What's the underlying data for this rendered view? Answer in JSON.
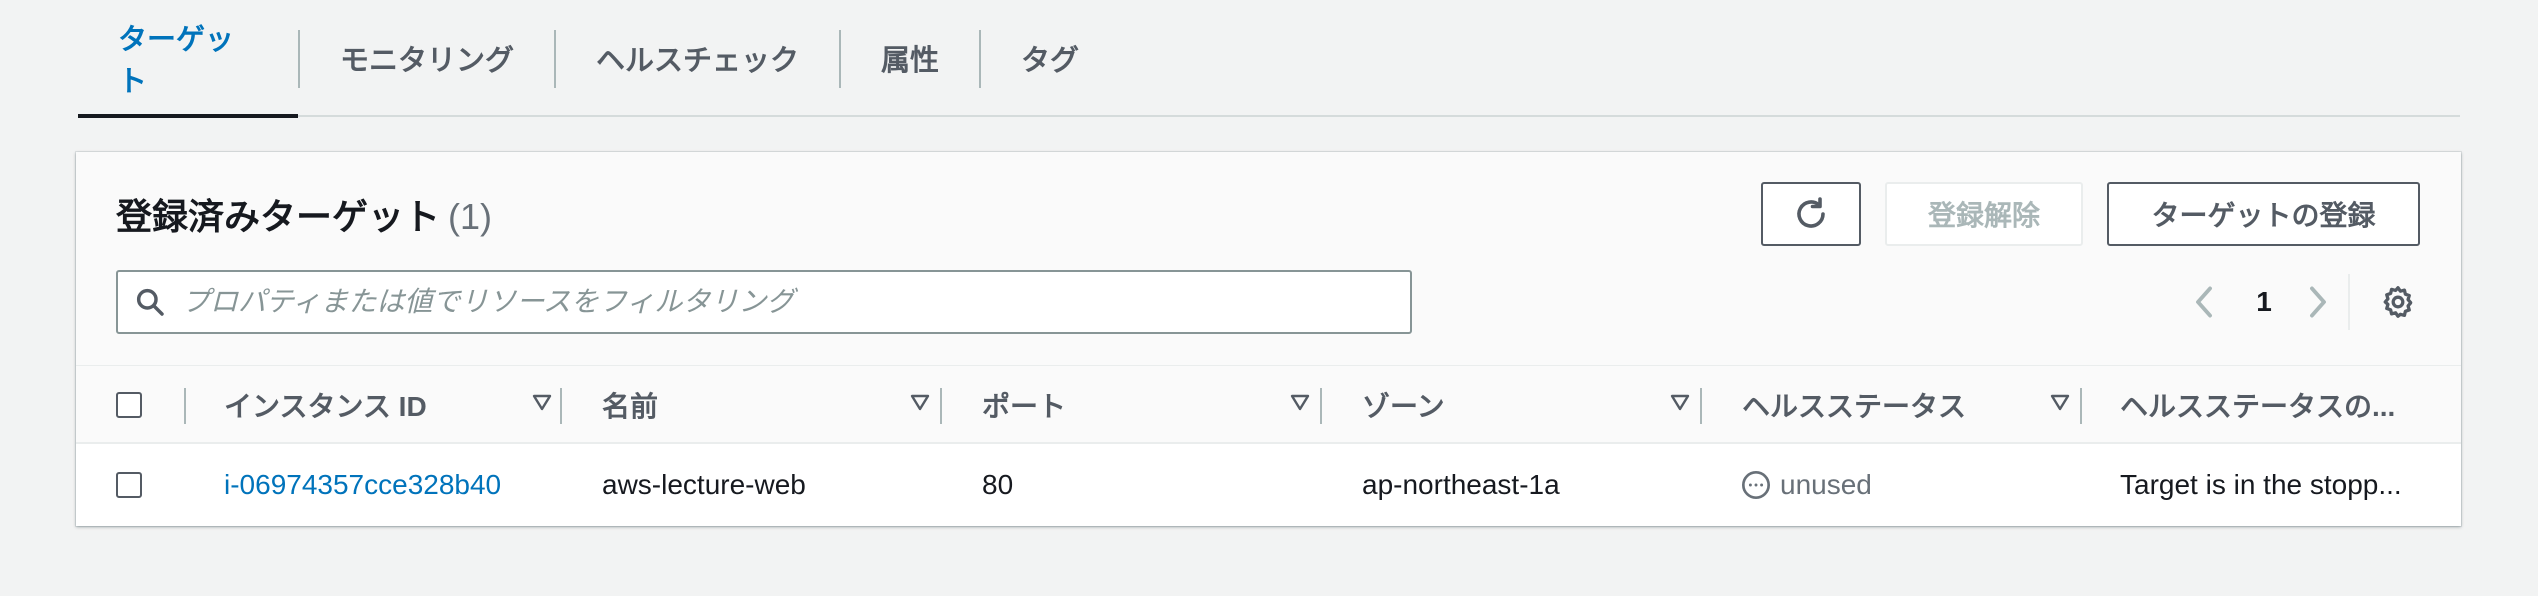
{
  "tabs": [
    {
      "label": "ターゲット",
      "active": true
    },
    {
      "label": "モニタリング"
    },
    {
      "label": "ヘルスチェック"
    },
    {
      "label": "属性"
    },
    {
      "label": "タグ"
    }
  ],
  "panel": {
    "title": "登録済みターゲット",
    "count": "(1)",
    "refresh_icon": "refresh-icon",
    "deregister_label": "登録解除",
    "register_label": "ターゲットの登録",
    "search_placeholder": "プロパティまたは値でリソースをフィルタリング",
    "page_number": "1"
  },
  "table": {
    "columns": [
      "インスタンス ID",
      "名前",
      "ポート",
      "ゾーン",
      "ヘルスステータス",
      "ヘルスステータスの..."
    ],
    "rows": [
      {
        "instance_id": "i-06974357cce328b40",
        "name": "aws-lecture-web",
        "port": "80",
        "zone": "ap-northeast-1a",
        "health": "unused",
        "health_detail": "Target is in the stopp..."
      }
    ]
  },
  "colors": {
    "accent": "#0073bb",
    "text": "#16191f",
    "muted": "#545b64",
    "background": "#f2f3f3"
  }
}
